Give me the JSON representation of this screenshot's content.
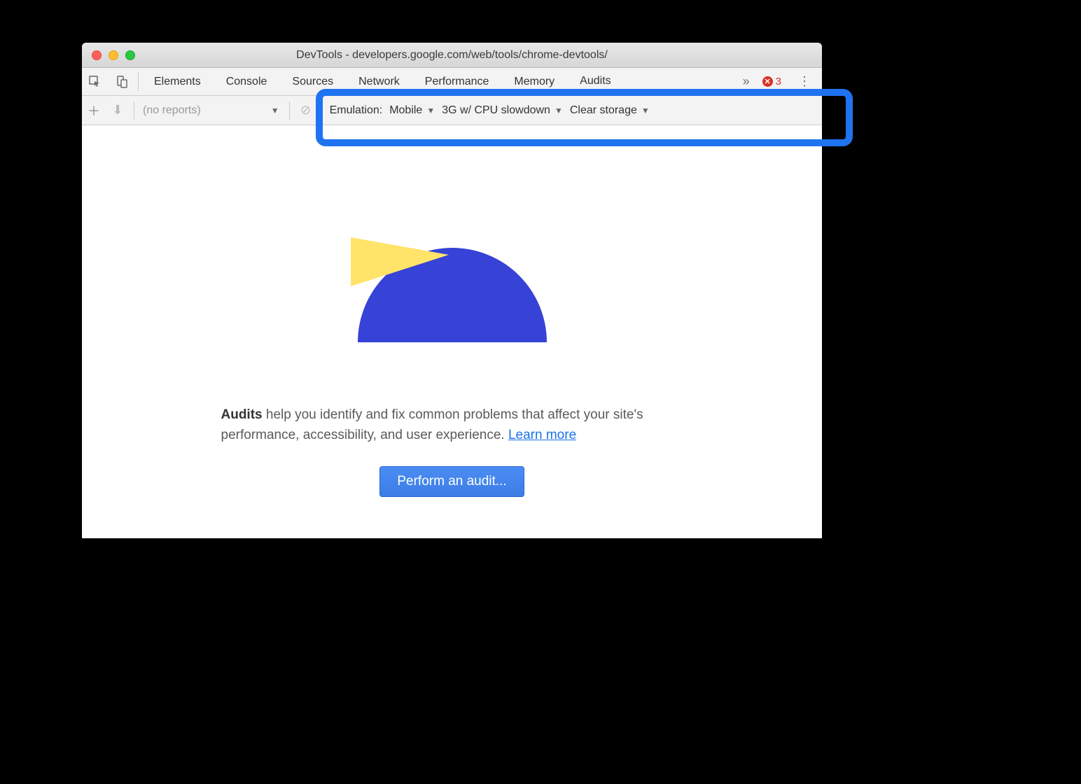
{
  "window": {
    "title": "DevTools - developers.google.com/web/tools/chrome-devtools/"
  },
  "tabbar": {
    "tabs": [
      "Elements",
      "Console",
      "Sources",
      "Network",
      "Performance",
      "Memory",
      "Audits"
    ],
    "active": "Audits",
    "error_count": "3"
  },
  "toolbar": {
    "reports_placeholder": "(no reports)",
    "emulation_label": "Emulation:",
    "emulation_device": "Mobile",
    "throttling": "3G w/ CPU slowdown",
    "storage": "Clear storage"
  },
  "content": {
    "desc_bold": "Audits",
    "desc_text": " help you identify and fix common problems that affect your site's performance, accessibility, and user experience. ",
    "learn_more": "Learn more",
    "button": "Perform an audit..."
  }
}
